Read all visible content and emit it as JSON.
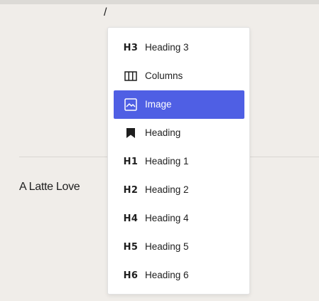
{
  "editor": {
    "typed_text": "/",
    "paragraph_text": "A Latte Love"
  },
  "inserter": {
    "selected_color": "#4f5fe4",
    "items": [
      {
        "label": "Heading 3",
        "icon": "heading-3-icon",
        "icon_text": "H3"
      },
      {
        "label": "Columns",
        "icon": "columns-icon"
      },
      {
        "label": "Image",
        "icon": "image-icon",
        "selected": true
      },
      {
        "label": "Heading",
        "icon": "bookmark-icon"
      },
      {
        "label": "Heading 1",
        "icon": "heading-1-icon",
        "icon_text": "H1"
      },
      {
        "label": "Heading 2",
        "icon": "heading-2-icon",
        "icon_text": "H2"
      },
      {
        "label": "Heading 4",
        "icon": "heading-4-icon",
        "icon_text": "H4"
      },
      {
        "label": "Heading 5",
        "icon": "heading-5-icon",
        "icon_text": "H5"
      },
      {
        "label": "Heading 6",
        "icon": "heading-6-icon",
        "icon_text": "H6"
      }
    ]
  }
}
